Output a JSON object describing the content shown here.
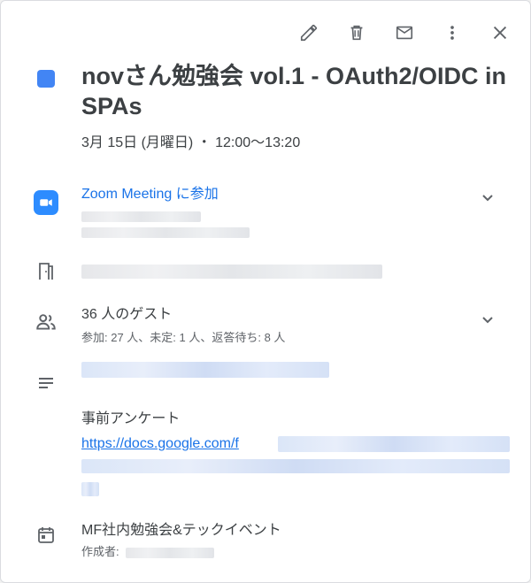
{
  "toolbar": {
    "edit_icon": "pencil-icon",
    "delete_icon": "trash-icon",
    "email_icon": "mail-icon",
    "more_icon": "more-vert-icon",
    "close_icon": "close-icon"
  },
  "event": {
    "color": "#4285f4",
    "title": "novさん勉強会 vol.1 - OAuth2/OIDC in SPAs",
    "datetime": "3月 15日 (月曜日)  ・  12:00〜13:20"
  },
  "conference": {
    "join_label": "Zoom Meeting に参加",
    "icon": "zoom-video-icon"
  },
  "location": {
    "icon": "door-icon"
  },
  "guests": {
    "count_label": "36 人のゲスト",
    "summary": "参加: 27 人、未定: 1 人、返答待ち: 8 人",
    "icon": "people-icon"
  },
  "description": {
    "icon": "notes-icon",
    "heading": "事前アンケート",
    "link_text": "https://docs.google.com/f"
  },
  "calendar": {
    "icon": "calendar-icon",
    "name": "MF社内勉強会&テックイベント",
    "creator_label": "作成者:"
  }
}
